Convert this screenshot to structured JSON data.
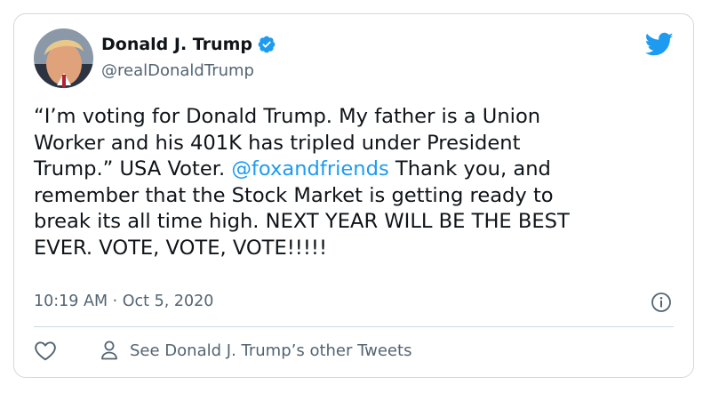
{
  "tweet": {
    "author": {
      "display_name": "Donald J. Trump",
      "handle": "@realDonaldTrump",
      "verified": true,
      "avatar_icon": "profile-photo"
    },
    "text_before_mention": "“I’m voting for Donald Trump. My father is a Union\nWorker and his 401K has tripled under President\nTrump.” USA Voter. ",
    "mention": "@foxandfriends",
    "text_after_mention": "  Thank you, and\nremember that the Stock Market is getting ready to\nbreak its all time high. NEXT YEAR WILL BE THE BEST\nEVER. VOTE, VOTE, VOTE!!!!!",
    "timestamp": "10:19 AM · Oct 5, 2020",
    "other_tweets_label": "See Donald J. Trump’s other Tweets"
  },
  "icons": {
    "brand": "twitter-bird-icon",
    "verified": "verified-badge-icon",
    "info": "info-icon",
    "like": "heart-icon",
    "profile": "person-icon"
  },
  "colors": {
    "link": "#1d9bf0",
    "secondary_text": "#536471",
    "border": "#cfd9de",
    "primary_text": "#0f1419"
  }
}
